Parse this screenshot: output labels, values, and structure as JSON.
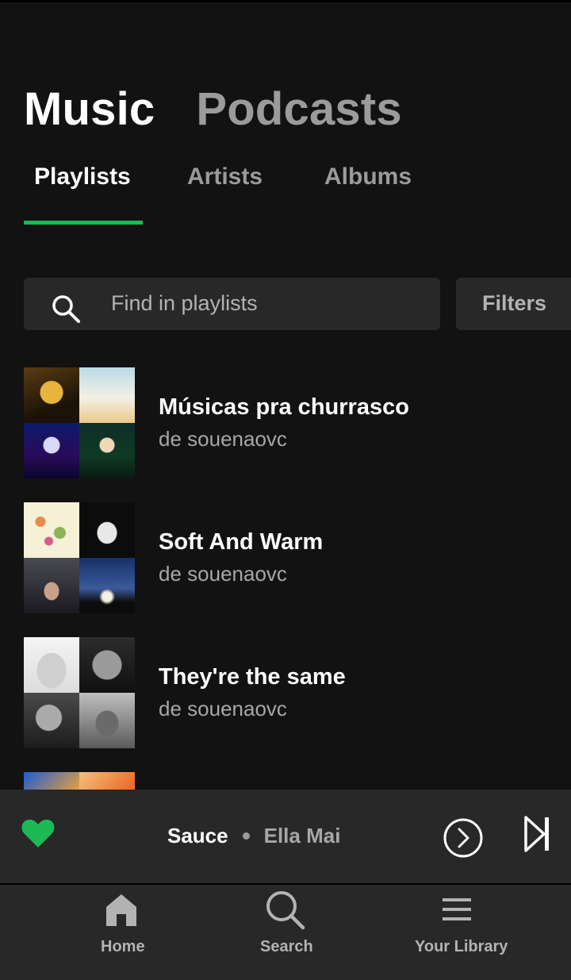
{
  "section_tabs": {
    "music": "Music",
    "podcasts": "Podcasts"
  },
  "sub_tabs": {
    "playlists": "Playlists",
    "artists": "Artists",
    "albums": "Albums"
  },
  "search": {
    "placeholder": "Find in playlists",
    "filters_label": "Filters"
  },
  "playlists": [
    {
      "title": "Músicas pra churrasco",
      "owner": "de souenaovc"
    },
    {
      "title": "Soft And Warm",
      "owner": "de souenaovc"
    },
    {
      "title": "They're the same",
      "owner": "de souenaovc"
    }
  ],
  "now_playing": {
    "track": "Sauce",
    "artist": "Ella Mai",
    "liked": true
  },
  "nav": {
    "home": "Home",
    "search": "Search",
    "library": "Your Library"
  },
  "colors": {
    "accent": "#1db954",
    "background": "#121212",
    "surface": "#282828",
    "text_primary": "#ffffff",
    "text_secondary": "#a7a7a7"
  },
  "icons": {
    "search": "search-icon",
    "heart": "heart-icon",
    "connect": "connect-device-icon",
    "next": "skip-next-icon",
    "home": "home-icon",
    "library": "library-icon"
  }
}
